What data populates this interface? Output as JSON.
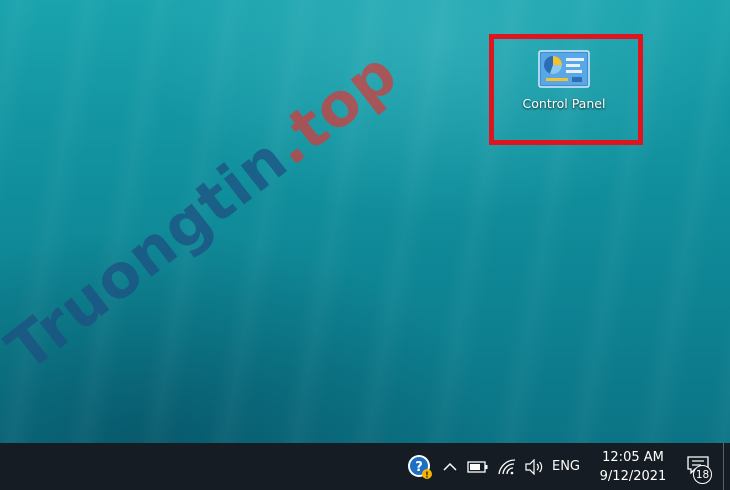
{
  "desktop": {
    "icons": [
      {
        "label": "Control Panel",
        "icon": "control-panel-icon"
      }
    ],
    "highlight_color": "#e0141e"
  },
  "watermark": {
    "main": "Truongtin",
    "dot": ".top"
  },
  "taskbar": {
    "tray": {
      "help_icon": "help-icon",
      "chevron_icon": "chevron-up-icon",
      "battery_icon": "battery-icon",
      "wifi_icon": "wifi-icon",
      "volume_icon": "volume-icon",
      "language": "ENG"
    },
    "clock": {
      "time": "12:05 AM",
      "date": "9/12/2021"
    },
    "notifications": {
      "count": "18"
    }
  }
}
